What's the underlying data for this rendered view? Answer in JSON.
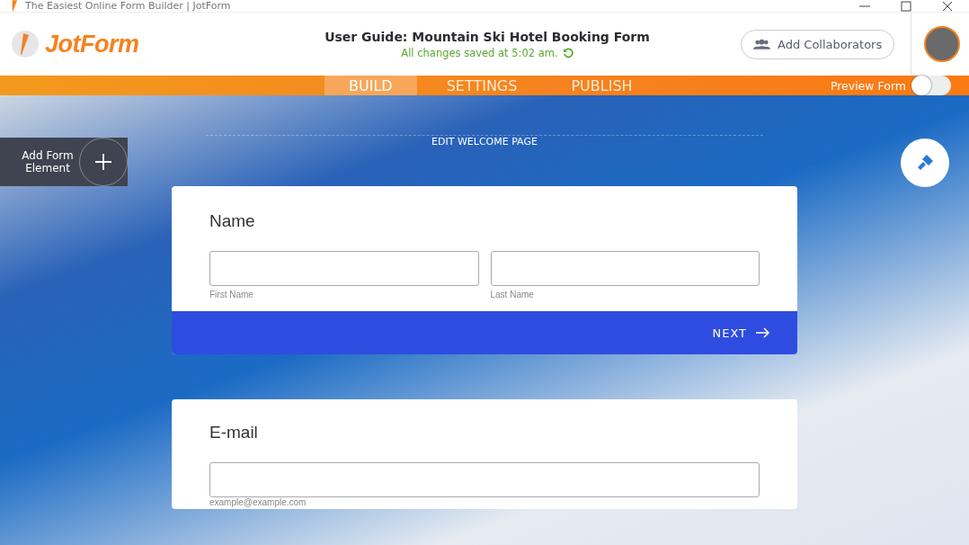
{
  "window": {
    "title": "The Easiest Online Form Builder | JotForm"
  },
  "header": {
    "logo": "JotForm",
    "form_title": "User Guide: Mountain Ski Hotel Booking Form",
    "save_status": "All changes saved at 5:02 am.",
    "collaborators_button": "Add Collaborators"
  },
  "tabs": [
    {
      "label": "BUILD",
      "selected": true
    },
    {
      "label": "SETTINGS",
      "selected": false
    },
    {
      "label": "PUBLISH",
      "selected": false
    }
  ],
  "preview": {
    "label": "Preview Form",
    "on": false
  },
  "canvas": {
    "add_element": "Add Form Element",
    "welcome_link": "EDIT WELCOME PAGE"
  },
  "cards": [
    {
      "kind": "name",
      "label": "Name",
      "fields": [
        {
          "sublabel": "First Name"
        },
        {
          "sublabel": "Last Name"
        }
      ],
      "next_button": "NEXT"
    },
    {
      "kind": "email",
      "label": "E-mail",
      "fields": [
        {
          "sublabel": "example@example.com"
        }
      ]
    }
  ]
}
